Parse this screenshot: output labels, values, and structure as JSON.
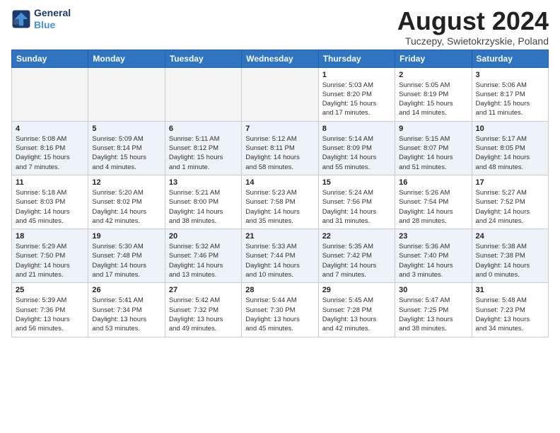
{
  "header": {
    "logo_line1": "General",
    "logo_line2": "Blue",
    "month_year": "August 2024",
    "location": "Tuczepy, Swietokrzyskie, Poland"
  },
  "weekdays": [
    "Sunday",
    "Monday",
    "Tuesday",
    "Wednesday",
    "Thursday",
    "Friday",
    "Saturday"
  ],
  "weeks": [
    [
      {
        "day": "",
        "info": ""
      },
      {
        "day": "",
        "info": ""
      },
      {
        "day": "",
        "info": ""
      },
      {
        "day": "",
        "info": ""
      },
      {
        "day": "1",
        "info": "Sunrise: 5:03 AM\nSunset: 8:20 PM\nDaylight: 15 hours\nand 17 minutes."
      },
      {
        "day": "2",
        "info": "Sunrise: 5:05 AM\nSunset: 8:19 PM\nDaylight: 15 hours\nand 14 minutes."
      },
      {
        "day": "3",
        "info": "Sunrise: 5:06 AM\nSunset: 8:17 PM\nDaylight: 15 hours\nand 11 minutes."
      }
    ],
    [
      {
        "day": "4",
        "info": "Sunrise: 5:08 AM\nSunset: 8:16 PM\nDaylight: 15 hours\nand 7 minutes."
      },
      {
        "day": "5",
        "info": "Sunrise: 5:09 AM\nSunset: 8:14 PM\nDaylight: 15 hours\nand 4 minutes."
      },
      {
        "day": "6",
        "info": "Sunrise: 5:11 AM\nSunset: 8:12 PM\nDaylight: 15 hours\nand 1 minute."
      },
      {
        "day": "7",
        "info": "Sunrise: 5:12 AM\nSunset: 8:11 PM\nDaylight: 14 hours\nand 58 minutes."
      },
      {
        "day": "8",
        "info": "Sunrise: 5:14 AM\nSunset: 8:09 PM\nDaylight: 14 hours\nand 55 minutes."
      },
      {
        "day": "9",
        "info": "Sunrise: 5:15 AM\nSunset: 8:07 PM\nDaylight: 14 hours\nand 51 minutes."
      },
      {
        "day": "10",
        "info": "Sunrise: 5:17 AM\nSunset: 8:05 PM\nDaylight: 14 hours\nand 48 minutes."
      }
    ],
    [
      {
        "day": "11",
        "info": "Sunrise: 5:18 AM\nSunset: 8:03 PM\nDaylight: 14 hours\nand 45 minutes."
      },
      {
        "day": "12",
        "info": "Sunrise: 5:20 AM\nSunset: 8:02 PM\nDaylight: 14 hours\nand 42 minutes."
      },
      {
        "day": "13",
        "info": "Sunrise: 5:21 AM\nSunset: 8:00 PM\nDaylight: 14 hours\nand 38 minutes."
      },
      {
        "day": "14",
        "info": "Sunrise: 5:23 AM\nSunset: 7:58 PM\nDaylight: 14 hours\nand 35 minutes."
      },
      {
        "day": "15",
        "info": "Sunrise: 5:24 AM\nSunset: 7:56 PM\nDaylight: 14 hours\nand 31 minutes."
      },
      {
        "day": "16",
        "info": "Sunrise: 5:26 AM\nSunset: 7:54 PM\nDaylight: 14 hours\nand 28 minutes."
      },
      {
        "day": "17",
        "info": "Sunrise: 5:27 AM\nSunset: 7:52 PM\nDaylight: 14 hours\nand 24 minutes."
      }
    ],
    [
      {
        "day": "18",
        "info": "Sunrise: 5:29 AM\nSunset: 7:50 PM\nDaylight: 14 hours\nand 21 minutes."
      },
      {
        "day": "19",
        "info": "Sunrise: 5:30 AM\nSunset: 7:48 PM\nDaylight: 14 hours\nand 17 minutes."
      },
      {
        "day": "20",
        "info": "Sunrise: 5:32 AM\nSunset: 7:46 PM\nDaylight: 14 hours\nand 13 minutes."
      },
      {
        "day": "21",
        "info": "Sunrise: 5:33 AM\nSunset: 7:44 PM\nDaylight: 14 hours\nand 10 minutes."
      },
      {
        "day": "22",
        "info": "Sunrise: 5:35 AM\nSunset: 7:42 PM\nDaylight: 14 hours\nand 7 minutes."
      },
      {
        "day": "23",
        "info": "Sunrise: 5:36 AM\nSunset: 7:40 PM\nDaylight: 14 hours\nand 3 minutes."
      },
      {
        "day": "24",
        "info": "Sunrise: 5:38 AM\nSunset: 7:38 PM\nDaylight: 14 hours\nand 0 minutes."
      }
    ],
    [
      {
        "day": "25",
        "info": "Sunrise: 5:39 AM\nSunset: 7:36 PM\nDaylight: 13 hours\nand 56 minutes."
      },
      {
        "day": "26",
        "info": "Sunrise: 5:41 AM\nSunset: 7:34 PM\nDaylight: 13 hours\nand 53 minutes."
      },
      {
        "day": "27",
        "info": "Sunrise: 5:42 AM\nSunset: 7:32 PM\nDaylight: 13 hours\nand 49 minutes."
      },
      {
        "day": "28",
        "info": "Sunrise: 5:44 AM\nSunset: 7:30 PM\nDaylight: 13 hours\nand 45 minutes."
      },
      {
        "day": "29",
        "info": "Sunrise: 5:45 AM\nSunset: 7:28 PM\nDaylight: 13 hours\nand 42 minutes."
      },
      {
        "day": "30",
        "info": "Sunrise: 5:47 AM\nSunset: 7:25 PM\nDaylight: 13 hours\nand 38 minutes."
      },
      {
        "day": "31",
        "info": "Sunrise: 5:48 AM\nSunset: 7:23 PM\nDaylight: 13 hours\nand 34 minutes."
      }
    ]
  ]
}
